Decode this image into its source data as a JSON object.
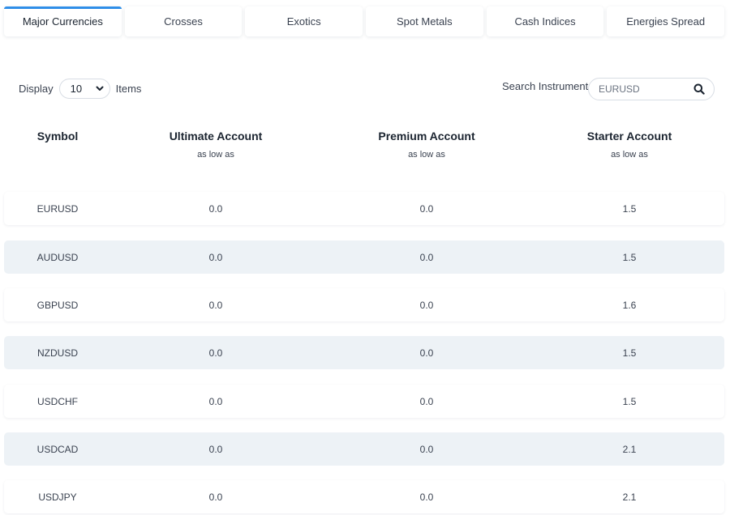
{
  "tabs": [
    {
      "label": "Major Currencies",
      "active": true
    },
    {
      "label": "Crosses"
    },
    {
      "label": "Exotics"
    },
    {
      "label": "Spot Metals"
    },
    {
      "label": "Cash Indices"
    },
    {
      "label": "Energies Spread"
    }
  ],
  "display": {
    "prefix": "Display",
    "value": "10",
    "suffix": "Items"
  },
  "search": {
    "label": "Search Instrument",
    "placeholder": "EURUSD"
  },
  "columns": [
    {
      "title": "Symbol",
      "sub": ""
    },
    {
      "title": "Ultimate Account",
      "sub": "as low as"
    },
    {
      "title": "Premium Account",
      "sub": "as low as"
    },
    {
      "title": "Starter Account",
      "sub": "as low as"
    }
  ],
  "rows": [
    {
      "symbol": "EURUSD",
      "ultimate": "0.0",
      "premium": "0.0",
      "starter": "1.5"
    },
    {
      "symbol": "AUDUSD",
      "ultimate": "0.0",
      "premium": "0.0",
      "starter": "1.5"
    },
    {
      "symbol": "GBPUSD",
      "ultimate": "0.0",
      "premium": "0.0",
      "starter": "1.6"
    },
    {
      "symbol": "NZDUSD",
      "ultimate": "0.0",
      "premium": "0.0",
      "starter": "1.5"
    },
    {
      "symbol": "USDCHF",
      "ultimate": "0.0",
      "premium": "0.0",
      "starter": "1.5"
    },
    {
      "symbol": "USDCAD",
      "ultimate": "0.0",
      "premium": "0.0",
      "starter": "2.1"
    },
    {
      "symbol": "USDJPY",
      "ultimate": "0.0",
      "premium": "0.0",
      "starter": "2.1"
    }
  ],
  "colors": {
    "accent": "#2f8ee8",
    "row_shade": "#edf2f6"
  },
  "icons": {
    "select": "chevron-down-icon",
    "search": "search-icon"
  }
}
